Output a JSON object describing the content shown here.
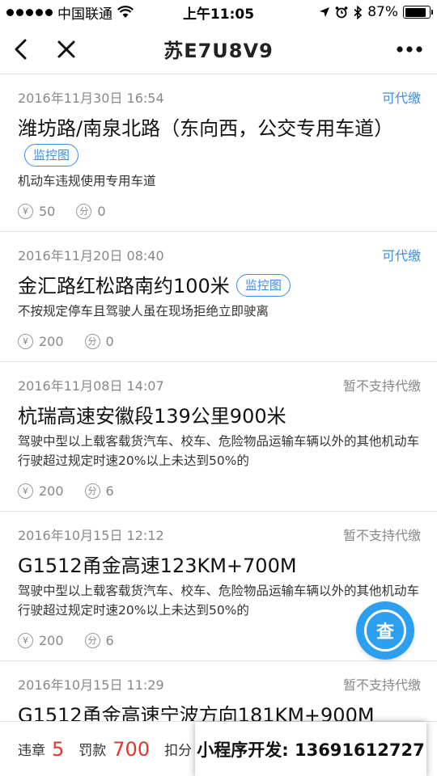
{
  "status_bar": {
    "carrier": "中国联通",
    "time": "上午11:05",
    "battery": "87%",
    "battery_level": 0.87
  },
  "nav": {
    "title": "苏E7U8V9"
  },
  "violations": [
    {
      "date": "2016年11月30日 16:54",
      "status": "可代缴",
      "status_type": "ok",
      "location": "潍坊路/南泉北路（东向西，公交专用车道）",
      "tag": "监控图",
      "description": "机动车违规使用专用车道",
      "fine_symbol": "¥",
      "fine": "50",
      "points_symbol": "分",
      "points": "0"
    },
    {
      "date": "2016年11月20日 08:40",
      "status": "可代缴",
      "status_type": "ok",
      "location": "金汇路红松路南约100米",
      "tag": "监控图",
      "description": "不按规定停车且驾驶人虽在现场拒绝立即驶离",
      "fine_symbol": "¥",
      "fine": "200",
      "points_symbol": "分",
      "points": "0"
    },
    {
      "date": "2016年11月08日 14:07",
      "status": "暂不支持代缴",
      "status_type": "no",
      "location": "杭瑞高速安徽段139公里900米",
      "tag": "",
      "description": "驾驶中型以上载客载货汽车、校车、危险物品运输车辆以外的其他机动车行驶超过规定时速20%以上未达到50%的",
      "fine_symbol": "¥",
      "fine": "200",
      "points_symbol": "分",
      "points": "6"
    },
    {
      "date": "2016年10月15日 12:12",
      "status": "暂不支持代缴",
      "status_type": "no",
      "location": "G1512甬金高速123KM+700M",
      "tag": "",
      "description": "驾驶中型以上载客载货汽车、校车、危险物品运输车辆以外的其他机动车行驶超过规定时速20%以上未达到50%的",
      "fine_symbol": "¥",
      "fine": "200",
      "points_symbol": "分",
      "points": "6"
    },
    {
      "date": "2016年10月15日 11:29",
      "status": "暂不支持代缴",
      "status_type": "no",
      "location": "G1512甬金高速宁波方向181KM+900M",
      "tag": "",
      "description": "",
      "fine_symbol": "¥",
      "fine": "",
      "points_symbol": "分",
      "points": ""
    }
  ],
  "fab": {
    "label": "查"
  },
  "summary": {
    "violations_label": "违章",
    "violations_count": "5",
    "fine_label": "罚款",
    "fine_total": "700",
    "points_label": "扣分"
  },
  "promo": {
    "text": "小程序开发: 13691612727"
  },
  "colors": {
    "accent": "#3a8ee6",
    "fab": "#2d9ff0",
    "highlight": "#e0352b"
  }
}
